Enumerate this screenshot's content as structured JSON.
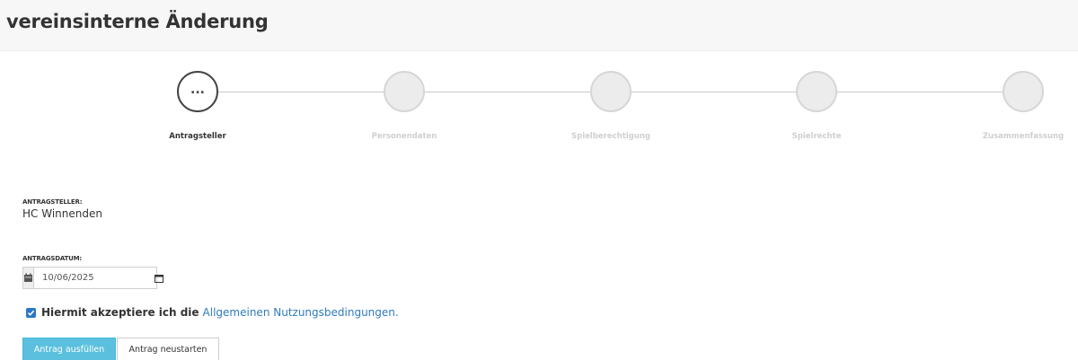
{
  "page": {
    "title": "vereinsinterne Änderung"
  },
  "stepper": {
    "active_symbol": "...",
    "steps": [
      {
        "label": "Antragsteller",
        "active": true
      },
      {
        "label": "Personendaten",
        "active": false
      },
      {
        "label": "Spielberechtigung",
        "active": false
      },
      {
        "label": "Spielrechte",
        "active": false
      },
      {
        "label": "Zusammenfassung",
        "active": false
      }
    ]
  },
  "form": {
    "applicant_label": "ANTRAGSTELLER:",
    "applicant_value": "HC Winnenden",
    "date_label": "ANTRAGSDATUM:",
    "date_value": "10/06/2025",
    "date_icon": "calendar-icon",
    "accept_text": "Hiermit akzeptiere ich die",
    "terms_link": "Allgemeinen Nutzungsbedingungen.",
    "accept_checked": true
  },
  "buttons": {
    "fill": "Antrag ausfüllen",
    "restart": "Antrag neustarten"
  },
  "colors": {
    "primary": "#5bc0de",
    "link": "#2f7bbf",
    "checkbox": "#2b78c5",
    "header_bg": "#f7f7f7"
  }
}
